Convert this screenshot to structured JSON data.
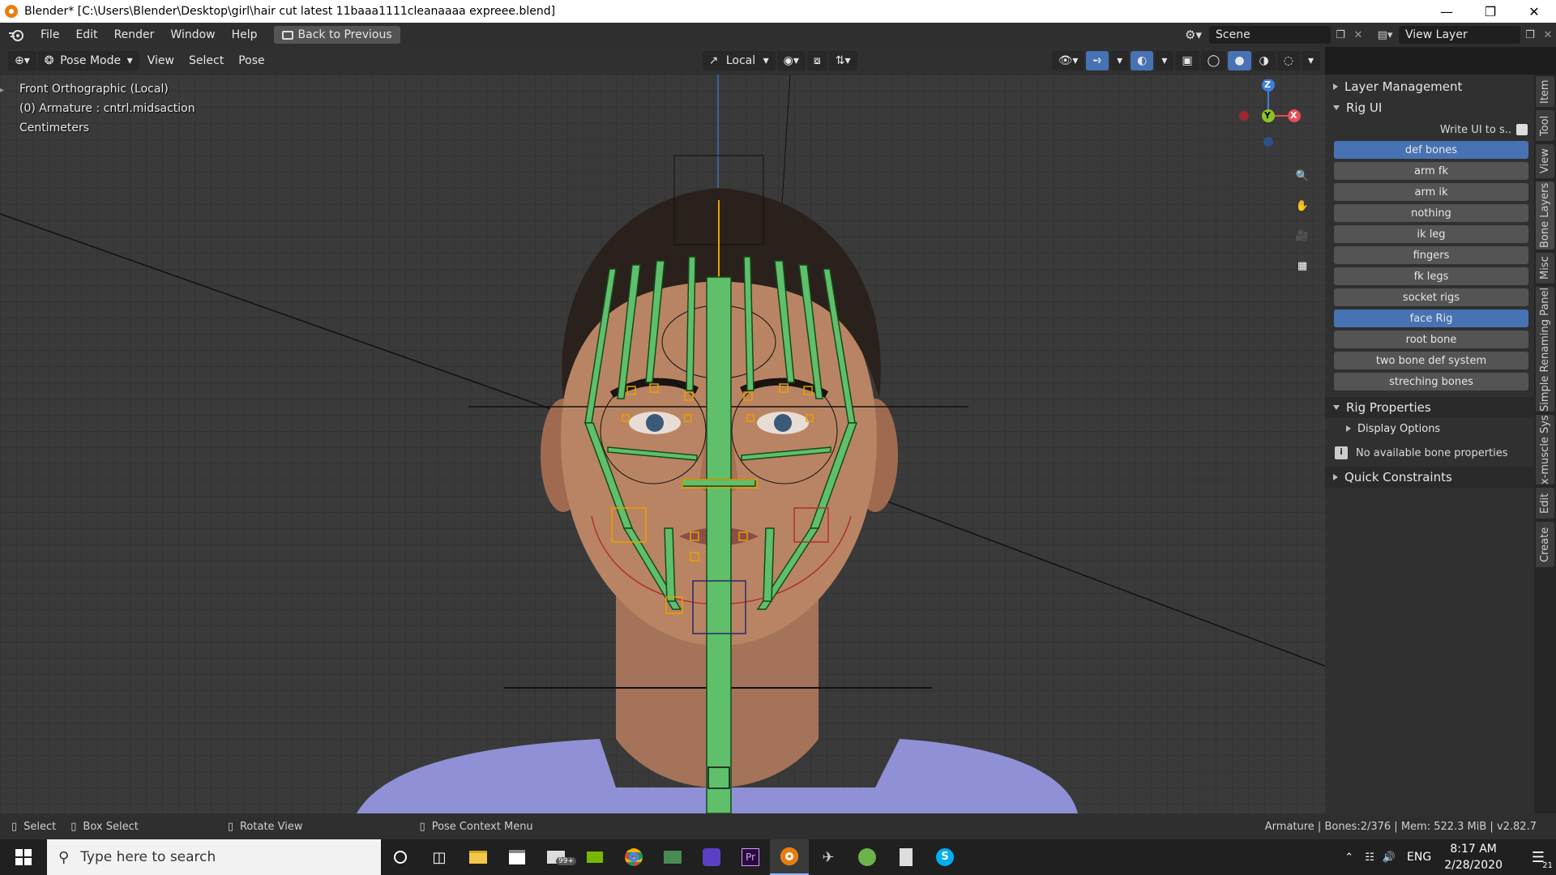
{
  "window": {
    "title": "Blender* [C:\\Users\\Blender\\Desktop\\girl\\hair cut latest 11baaa1111cleanaaaa expreee.blend]"
  },
  "menu": {
    "items": [
      "File",
      "Edit",
      "Render",
      "Window",
      "Help"
    ],
    "back_button": "Back to Previous"
  },
  "scene": {
    "name": "Scene",
    "view_layer": "View Layer"
  },
  "viewport_header": {
    "mode": "Pose Mode",
    "menus": [
      "View",
      "Select",
      "Pose"
    ],
    "transform_orientation": "Local"
  },
  "viewport_overlay": {
    "view_name": "Front Orthographic (Local)",
    "object_info": "(0) Armature : cntrl.midsaction",
    "units": "Centimeters"
  },
  "gizmo": {
    "z": "Z",
    "y": "Y",
    "x": "X"
  },
  "sidebar": {
    "layer_management": "Layer Management",
    "rig_ui": "Rig UI",
    "write_ui": "Write UI to s..",
    "rig_buttons": [
      {
        "label": "def bones",
        "active": true
      },
      {
        "label": "arm fk",
        "active": false
      },
      {
        "label": "arm ik",
        "active": false
      },
      {
        "label": "nothing",
        "active": false
      },
      {
        "label": "ik leg",
        "active": false
      },
      {
        "label": "fingers",
        "active": false
      },
      {
        "label": "fk legs",
        "active": false
      },
      {
        "label": "socket rigs",
        "active": false
      },
      {
        "label": "face Rig",
        "active": true
      },
      {
        "label": "root bone",
        "active": false
      },
      {
        "label": "two bone def system",
        "active": false
      },
      {
        "label": "streching bones",
        "active": false
      }
    ],
    "rig_properties": "Rig Properties",
    "display_options": "Display Options",
    "no_bone_props": "No available bone properties",
    "quick_constraints": "Quick Constraints"
  },
  "tabs": [
    "Item",
    "Tool",
    "View",
    "Bone Layers",
    "Misc",
    "Simple Renaming Panel",
    "x-muscle Sys",
    "Edit",
    "Create"
  ],
  "statusbar": {
    "select": "Select",
    "box_select": "Box Select",
    "rotate_view": "Rotate View",
    "context_menu": "Pose Context Menu",
    "stats": "Armature | Bones:2/376  |  Mem: 522.3 MiB | v2.82.7"
  },
  "taskbar": {
    "search_placeholder": "Type here to search",
    "mail_badge": "99+",
    "lang": "ENG",
    "time": "8:17 AM",
    "date": "2/28/2020",
    "notif_count": "21"
  },
  "colors": {
    "accent": "#4772b3",
    "bone_green": "#5fbf6a",
    "skin": "#b98463",
    "shirt": "#8f90d6"
  }
}
